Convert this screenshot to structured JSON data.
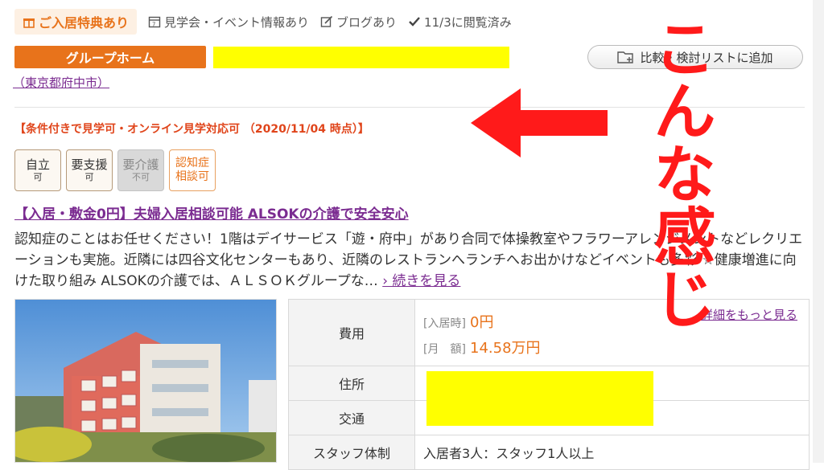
{
  "tags": {
    "special": "ご入居特典あり",
    "tour": "見学会・イベント情報あり",
    "blog": "ブログあり",
    "viewed": "11/3に閲覧済み"
  },
  "facility": {
    "type_badge": "グループホーム",
    "location": "（東京都府中市）",
    "favorite_button": "比較・検討リストに追加"
  },
  "visit_condition": "【条件付きで見学可・オンライン見学対応可 （2020/11/04 時点）】",
  "care_levels": [
    {
      "main": "自立",
      "sub": "可"
    },
    {
      "main": "要支援",
      "sub": "可"
    },
    {
      "main": "要介護",
      "sub": "不可"
    },
    {
      "main": "認知症",
      "sub": "相談可"
    }
  ],
  "headline": "【入居・敷金0円】夫婦入居相談可能 ALSOKの介護で安全安心",
  "description": "認知症のことはお任せください！1階はデイサービス「遊・府中」があり合同で体操教室やフラワーアレンジメントなどレクリエーションも実施。近隣には四谷文化センターもあり、近隣のレストランへランチへお出かけなどイベントも多彩 ☆健康増進に向けた取り組み ALSOKの介護では、ＡＬＳＯＫグループな…",
  "more_link": "› 続きを見る",
  "table": {
    "detail_link": "詳細をもっと見る",
    "rows": [
      {
        "label": "費用"
      },
      {
        "label": "住所"
      },
      {
        "label": "交通"
      },
      {
        "label": "スタッフ体制",
        "value": "入居者3人：スタッフ1人以上"
      }
    ],
    "fee": {
      "move_in_label": "[入居時]",
      "move_in_value": "0円",
      "monthly_label": "[月　額]",
      "monthly_value": "14.58万円"
    }
  },
  "overlay": "こんな感じ",
  "colors": {
    "accent": "#e8731b",
    "link": "#7b2c91",
    "alert": "#e0451b",
    "overlay": "#ff1a1a",
    "mask": "#ffff00"
  }
}
